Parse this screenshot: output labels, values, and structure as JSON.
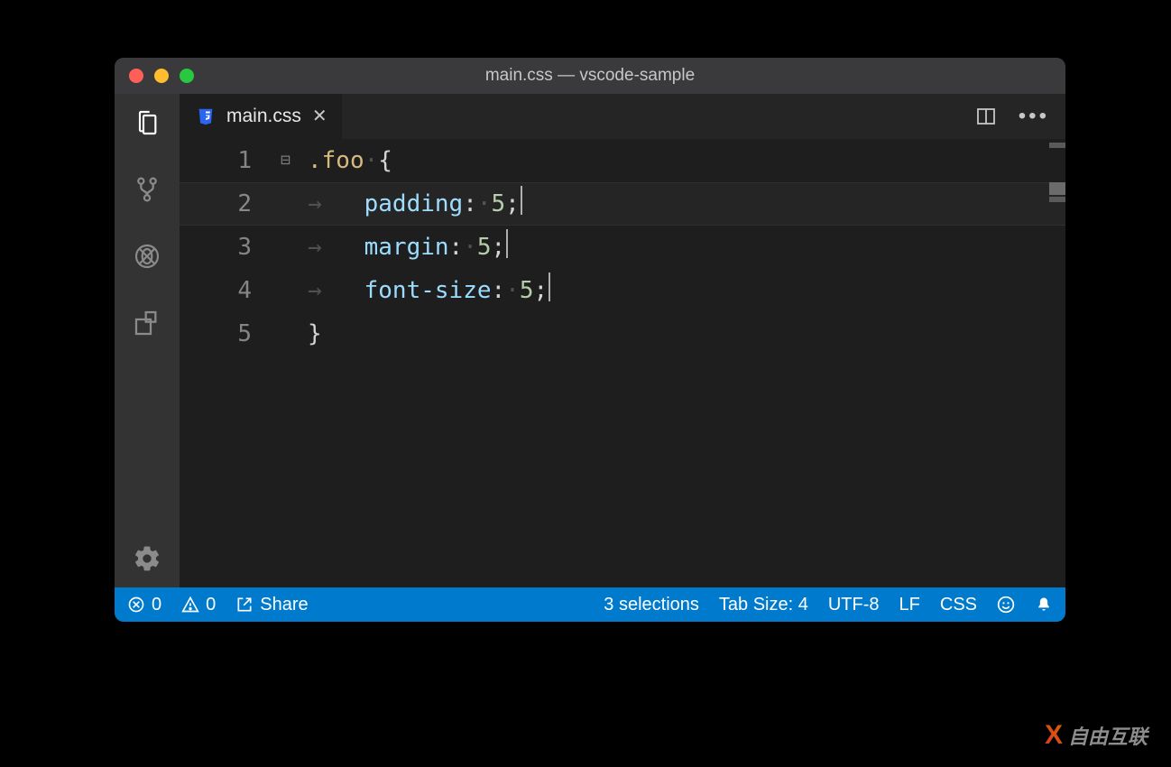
{
  "title": "main.css — vscode-sample",
  "tab": {
    "filename": "main.css"
  },
  "gutter": [
    "1",
    "2",
    "3",
    "4",
    "5"
  ],
  "code": {
    "l1_sel": ".foo",
    "l1_brace": "{",
    "l2_prop": "padding",
    "l2_colon": ":",
    "l2_val": "5",
    "l2_semi": ";",
    "l3_prop": "margin",
    "l3_colon": ":",
    "l3_val": "5",
    "l3_semi": ";",
    "l4_prop": "font-size",
    "l4_colon": ":",
    "l4_val": "5",
    "l4_semi": ";",
    "l5_brace": "}"
  },
  "status": {
    "errors": "0",
    "warnings": "0",
    "share": "Share",
    "selections": "3 selections",
    "tabsize": "Tab Size: 4",
    "encoding": "UTF-8",
    "eol": "LF",
    "lang": "CSS"
  },
  "watermark": "自由互联"
}
